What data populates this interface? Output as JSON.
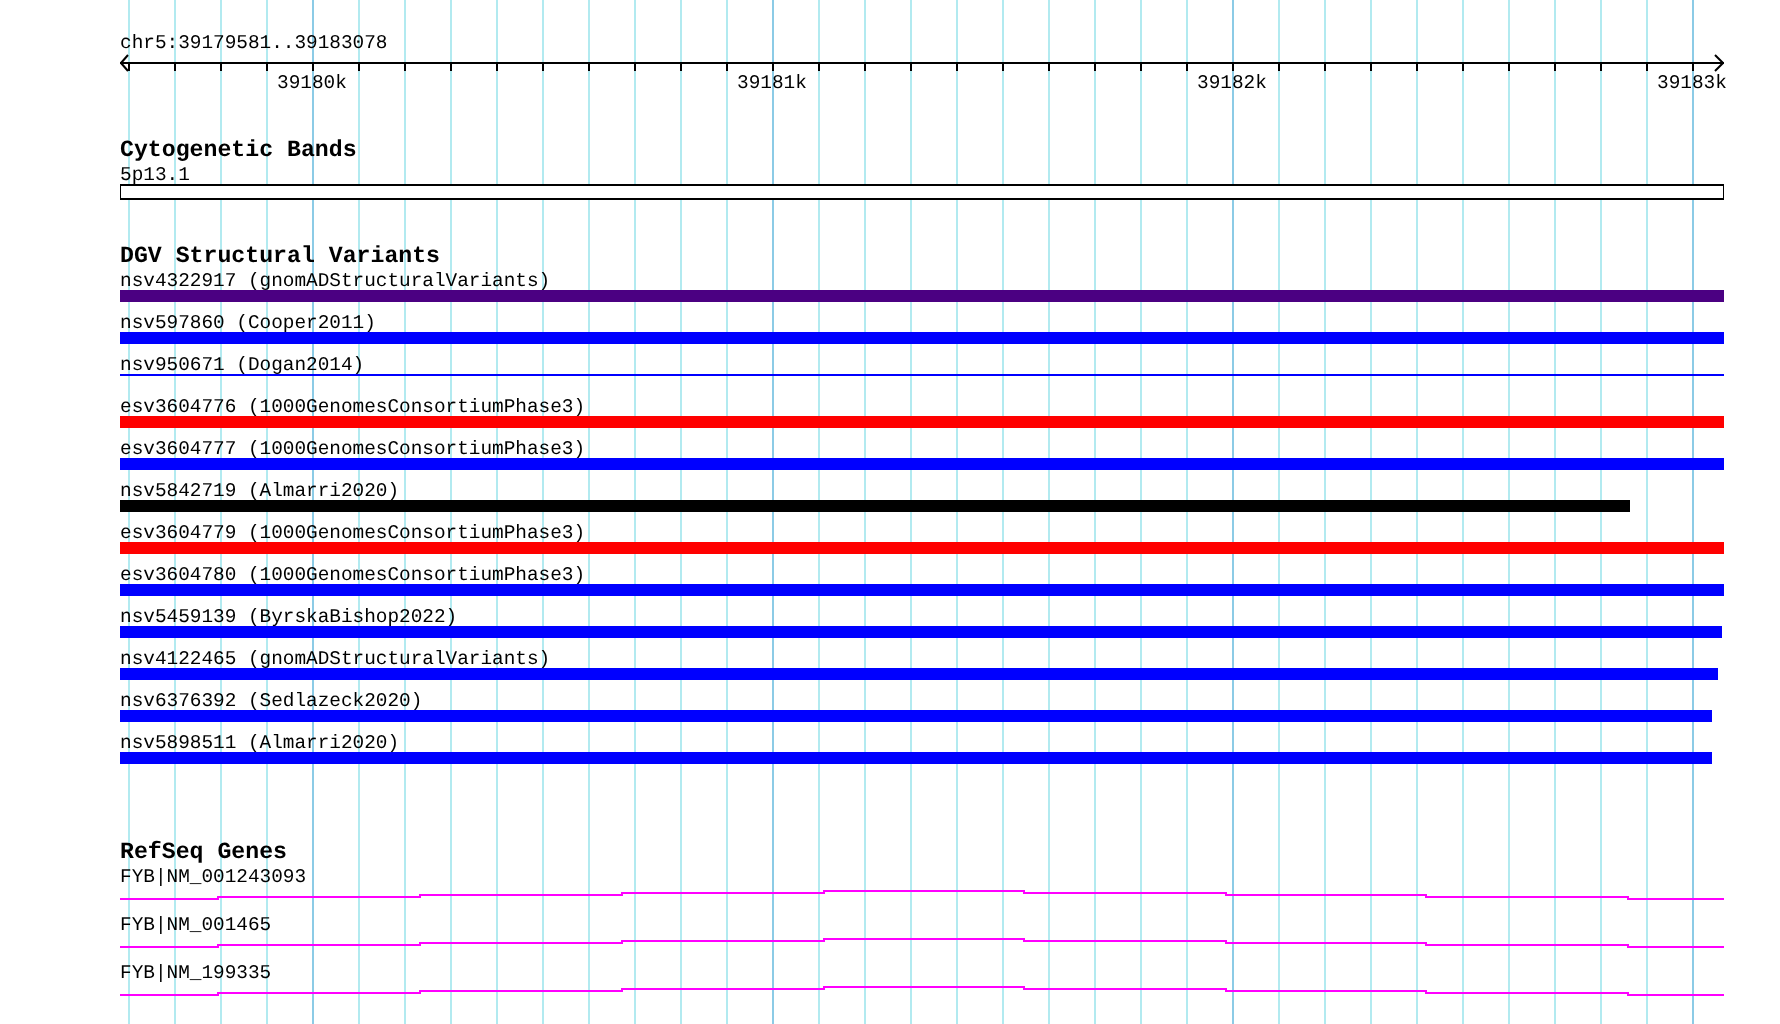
{
  "ruler": {
    "location": "chr5:39179581..39183078",
    "tick_labels": [
      "39180k",
      "39181k",
      "39182k",
      "39183k"
    ]
  },
  "tracks": [
    {
      "kind": "cytoband",
      "title": "Cytogenetic Bands",
      "features": [
        {
          "label": "5p13.1"
        }
      ]
    },
    {
      "kind": "variants",
      "title": "DGV Structural Variants",
      "features": [
        {
          "label": "nsv4322917 (gnomADStructuralVariants)",
          "kind": "bar",
          "color": "#4b0082",
          "level": 1
        },
        {
          "label": "nsv597860 (Cooper2011)",
          "kind": "bar",
          "color": "#0000ff",
          "level": 1
        },
        {
          "label": "nsv950671 (Dogan2014)",
          "kind": "line",
          "color": "#0000ff",
          "level": 1
        },
        {
          "label": "esv3604776 (1000GenomesConsortiumPhase3)",
          "kind": "bar",
          "color": "#ff0000",
          "level": 1
        },
        {
          "label": "esv3604777 (1000GenomesConsortiumPhase3)",
          "kind": "bar",
          "color": "#0000ff",
          "level": 1
        },
        {
          "label": "nsv5842719 (Almarri2020)",
          "kind": "bar",
          "color": "#000000",
          "level": 0.941
        },
        {
          "label": "esv3604779 (1000GenomesConsortiumPhase3)",
          "kind": "bar",
          "color": "#ff0000",
          "level": 1
        },
        {
          "label": "esv3604780 (1000GenomesConsortiumPhase3)",
          "kind": "bar",
          "color": "#0000ff",
          "level": 1
        },
        {
          "label": "nsv5459139 (ByrskaBishop2022)",
          "kind": "bar",
          "color": "#0000ff",
          "level": 0.999
        },
        {
          "label": "nsv4122465 (gnomADStructuralVariants)",
          "kind": "bar",
          "color": "#0000ff",
          "level": 0.996
        },
        {
          "label": "nsv6376392 (Sedlazeck2020)",
          "kind": "bar",
          "color": "#0000ff",
          "level": 0.993
        },
        {
          "label": "nsv5898511 (Almarri2020)",
          "kind": "bar",
          "color": "#0000ff",
          "level": 0.993
        }
      ]
    },
    {
      "kind": "genes",
      "title": "RefSeq Genes",
      "features": [
        {
          "label": "FYB|NM_001243093"
        },
        {
          "label": "FYB|NM_001465"
        },
        {
          "label": "FYB|NM_199335"
        }
      ]
    }
  ]
}
